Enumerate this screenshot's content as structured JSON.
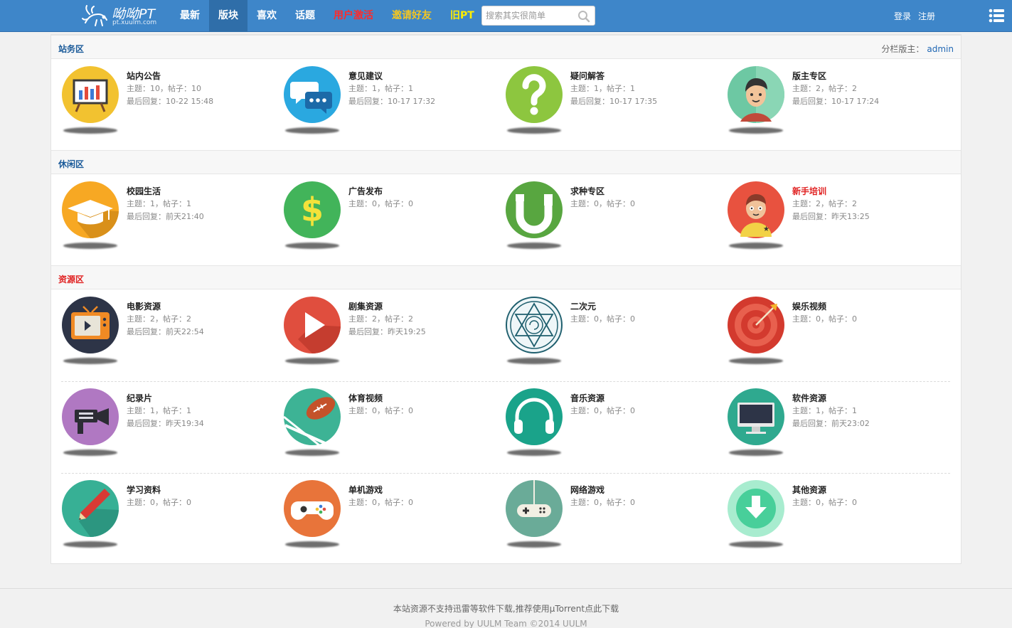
{
  "brand": {
    "title": "呦呦PT",
    "subtitle": "pt.xuulm.com"
  },
  "nav": [
    {
      "label": "最新",
      "color": "#ffffff"
    },
    {
      "label": "版块",
      "color": "#ffffff"
    },
    {
      "label": "喜欢",
      "color": "#ffffff"
    },
    {
      "label": "话题",
      "color": "#ffffff"
    },
    {
      "label": "用户激活",
      "color": "#ff2a2a"
    },
    {
      "label": "邀请好友",
      "color": "#f3c622"
    },
    {
      "label": "旧PT",
      "color": "#ffee00"
    }
  ],
  "search": {
    "placeholder": "搜索其实很简单"
  },
  "auth": {
    "login": "登录",
    "register": "注册"
  },
  "sections": [
    {
      "title": "站务区",
      "moderator_label": "分栏版主：",
      "moderator": "admin"
    },
    {
      "title": "休闲区"
    },
    {
      "title": "资源区"
    }
  ],
  "forums": {
    "s0": [
      {
        "name": "站内公告",
        "stat": "主题：10，帖子：10",
        "last": "最后回复：10-22 15:48",
        "icon": "presentation-board-icon"
      },
      {
        "name": "意见建议",
        "stat": "主题：1，帖子：1",
        "last": "最后回复：10-17 17:32",
        "icon": "chat-bubbles-icon"
      },
      {
        "name": "疑问解答",
        "stat": "主题：1，帖子：1",
        "last": "最后回复：10-17 17:35",
        "icon": "question-mark-icon"
      },
      {
        "name": "版主专区",
        "stat": "主题：2，帖子：2",
        "last": "最后回复：10-17 17:24",
        "icon": "moderator-avatar-icon"
      }
    ],
    "s1": [
      {
        "name": "校园生活",
        "stat": "主题：1，帖子：1",
        "last": "最后回复：前天21:40",
        "icon": "graduation-cap-icon"
      },
      {
        "name": "广告发布",
        "stat": "主题：0，帖子：0",
        "last": "",
        "icon": "dollar-icon"
      },
      {
        "name": "求种专区",
        "stat": "主题：0，帖子：0",
        "last": "",
        "icon": "utorrent-icon"
      },
      {
        "name": "新手培训",
        "stat": "主题：2，帖子：2",
        "last": "最后回复：昨天13:25",
        "icon": "newbie-avatar-icon"
      }
    ],
    "s2": [
      {
        "name": "电影资源",
        "stat": "主题：2，帖子：2",
        "last": "最后回复：前天22:54",
        "icon": "tv-icon"
      },
      {
        "name": "剧集资源",
        "stat": "主题：2，帖子：2",
        "last": "最后回复：昨天19:25",
        "icon": "play-icon"
      },
      {
        "name": "二次元",
        "stat": "主题：0，帖子：0",
        "last": "",
        "icon": "magic-circle-icon"
      },
      {
        "name": "娱乐视频",
        "stat": "主题：0，帖子：0",
        "last": "",
        "icon": "target-icon"
      },
      {
        "name": "纪录片",
        "stat": "主题：1，帖子：1",
        "last": "最后回复：昨天19:34",
        "icon": "video-camera-icon"
      },
      {
        "name": "体育视频",
        "stat": "主题：0，帖子：0",
        "last": "",
        "icon": "football-icon"
      },
      {
        "name": "音乐资源",
        "stat": "主题：0，帖子：0",
        "last": "",
        "icon": "headphones-icon"
      },
      {
        "name": "软件资源",
        "stat": "主题：1，帖子：1",
        "last": "最后回复：前天23:02",
        "icon": "monitor-icon"
      },
      {
        "name": "学习资料",
        "stat": "主题：0，帖子：0",
        "last": "",
        "icon": "pencil-icon"
      },
      {
        "name": "单机游戏",
        "stat": "主题：0，帖子：0",
        "last": "",
        "icon": "gamepad-icon"
      },
      {
        "name": "网络游戏",
        "stat": "主题：0，帖子：0",
        "last": "",
        "icon": "controller-icon"
      },
      {
        "name": "其他资源",
        "stat": "主题：0，帖子：0",
        "last": "",
        "icon": "download-icon"
      }
    ]
  },
  "footer": {
    "notice": "本站资源不支持迅雷等软件下载,推荐使用μTorrent点此下载",
    "copyright": "Powered by UULM Team ©2014 UULM"
  },
  "colors": {
    "header": "#3e86c9",
    "nav_active": "#2f6ea9",
    "section_title": "#1a5a99",
    "highlight_red": "#e02020"
  }
}
